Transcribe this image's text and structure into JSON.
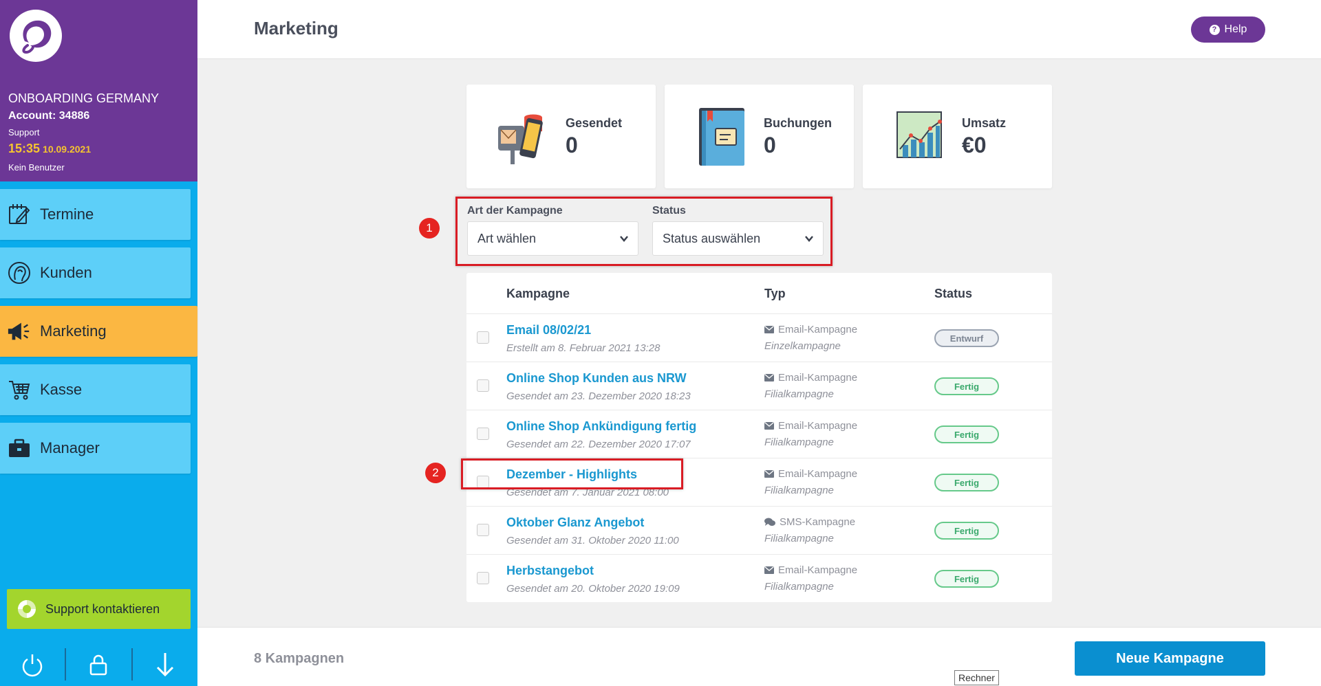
{
  "account": {
    "name": "ONBOARDING GERMANY",
    "number": "Account: 34886",
    "role": "Support",
    "time": "15:35",
    "date": "10.09.2021",
    "user": "Kein Benutzer"
  },
  "nav": {
    "items": [
      {
        "label": "Termine",
        "icon": "calendar-edit-icon"
      },
      {
        "label": "Kunden",
        "icon": "customer-head-icon"
      },
      {
        "label": "Marketing",
        "icon": "megaphone-icon",
        "active": true
      },
      {
        "label": "Kasse",
        "icon": "cart-icon"
      },
      {
        "label": "Manager",
        "icon": "briefcase-icon"
      }
    ]
  },
  "support": {
    "label": "Support kontaktieren"
  },
  "header": {
    "title": "Marketing",
    "help_label": "Help"
  },
  "stats": {
    "sent": {
      "label": "Gesendet",
      "value": "0"
    },
    "bookings": {
      "label": "Buchungen",
      "value": "0"
    },
    "revenue": {
      "label": "Umsatz",
      "value": "€0"
    }
  },
  "filters": {
    "type": {
      "label": "Art der Kampagne",
      "value": "Art wählen"
    },
    "status": {
      "label": "Status",
      "value": "Status auswählen"
    }
  },
  "annotations": {
    "one": "1",
    "two": "2"
  },
  "table": {
    "columns": {
      "campaign": "Kampagne",
      "type": "Typ",
      "status": "Status"
    },
    "rows": [
      {
        "name": "Email 08/02/21",
        "meta": "Erstellt am 8. Februar 2021 13:28",
        "type": "Email-Kampagne",
        "scope": "Einzelkampagne",
        "status": "Entwurf"
      },
      {
        "name": "Online Shop Kunden aus NRW",
        "meta": "Gesendet am 23. Dezember 2020 18:23",
        "type": "Email-Kampagne",
        "scope": "Filialkampagne",
        "status": "Fertig"
      },
      {
        "name": "Online Shop Ankündigung fertig",
        "meta": "Gesendet am 22. Dezember 2020 17:07",
        "type": "Email-Kampagne",
        "scope": "Filialkampagne",
        "status": "Fertig"
      },
      {
        "name": "Dezember - Highlights",
        "meta": "Gesendet am 7. Januar 2021 08:00",
        "type": "Email-Kampagne",
        "scope": "Filialkampagne",
        "status": "Fertig"
      },
      {
        "name": "Oktober Glanz Angebot",
        "meta": "Gesendet am 31. Oktober 2020 11:00",
        "type": "SMS-Kampagne",
        "scope": "Filialkampagne",
        "status": "Fertig"
      },
      {
        "name": "Herbstangebot",
        "meta": "Gesendet am 20. Oktober 2020 19:09",
        "type": "Email-Kampagne",
        "scope": "Filialkampagne",
        "status": "Fertig"
      }
    ]
  },
  "footer": {
    "count": "8 Kampagnen",
    "new_campaign_label": "Neue Kampagne"
  },
  "tooltip": {
    "text": "Rechner"
  },
  "colors": {
    "purple": "#6c3796",
    "sidebar": "#0aacec",
    "nav": "#5dcff8",
    "active": "#fbb742",
    "support": "#a3d52d",
    "primary": "#0a8fd0",
    "annotation": "#d91c24"
  }
}
